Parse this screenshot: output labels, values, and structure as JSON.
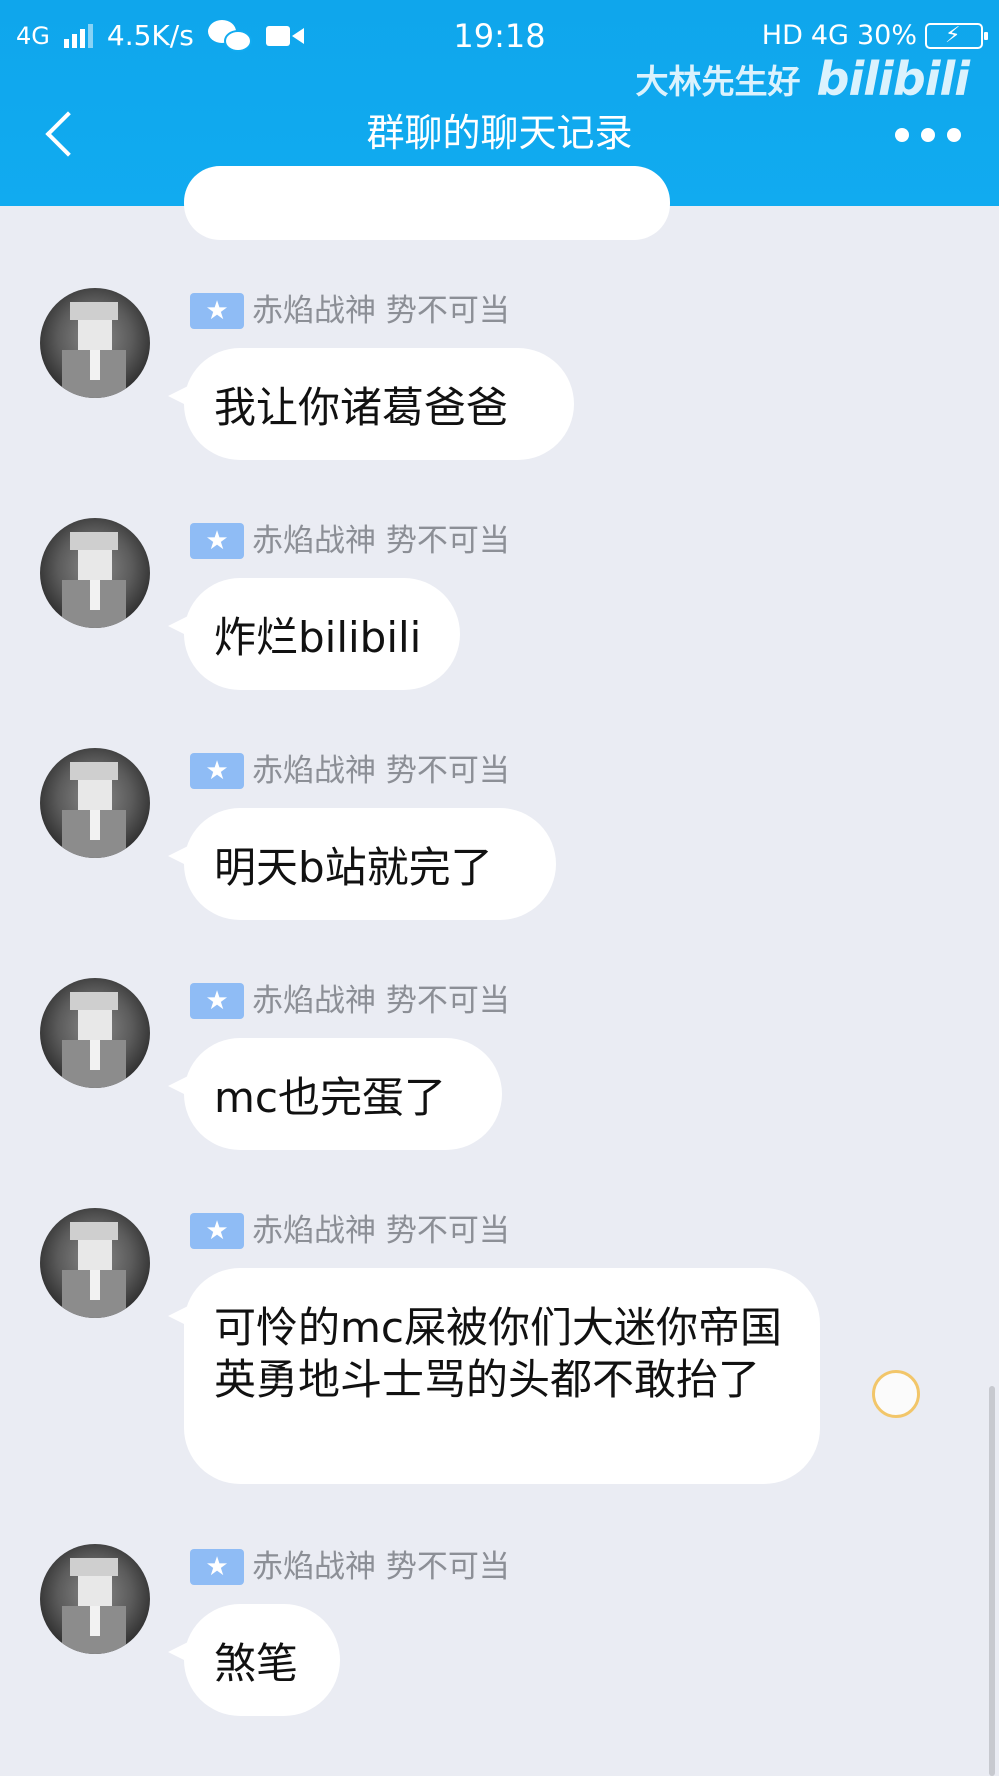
{
  "status_bar": {
    "network": "4G",
    "speed": "4.5K/s",
    "time": "19:18",
    "hd": "HD",
    "net_type": "4G",
    "battery": "30%"
  },
  "watermark": {
    "user": "大林先生好",
    "brand": "bilibili"
  },
  "header": {
    "title": "群聊的聊天记录",
    "bg_color": "#11abf0"
  },
  "icons": {
    "back": "chevron-left-icon",
    "more": "more-dots-icon",
    "wechat": "wechat-icon",
    "video": "video-camera-icon",
    "battery": "battery-icon"
  },
  "badge_symbol": "★",
  "messages": [
    {
      "sender": "赤焰战神 势不可当",
      "text": "我让你诸葛爸爸"
    },
    {
      "sender": "赤焰战神 势不可当",
      "text": "炸烂bilibili"
    },
    {
      "sender": "赤焰战神 势不可当",
      "text": "明天b站就完了"
    },
    {
      "sender": "赤焰战神 势不可当",
      "text": "mc也完蛋了"
    },
    {
      "sender": "赤焰战神 势不可当",
      "text": "可怜的mc屎被你们大迷你帝国英勇地斗士骂的头都不敢抬了"
    },
    {
      "sender": "赤焰战神 势不可当",
      "text": "煞笔"
    }
  ]
}
